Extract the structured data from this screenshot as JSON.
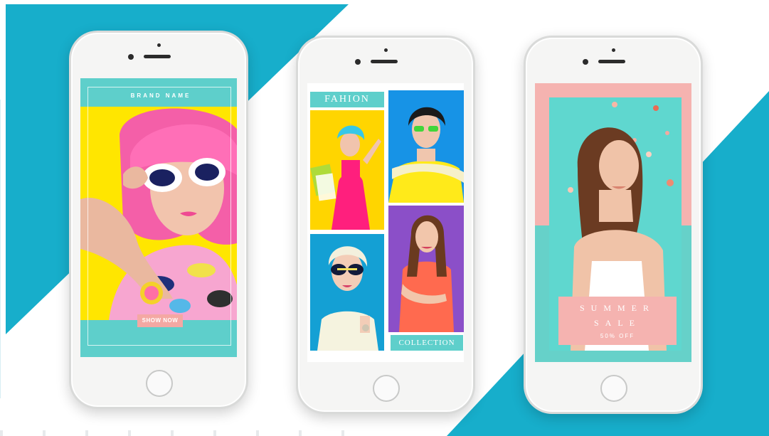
{
  "phones": [
    {
      "brand_name": "BRAND NAME",
      "button_label": "SHOW NOW"
    },
    {
      "title": "FAHION",
      "footer_label": "COLLECTION"
    },
    {
      "sale_line1": "SUMMER",
      "sale_line2": "SALE",
      "sale_line3": "50% OFF"
    }
  ],
  "colors": {
    "accent_teal": "#17aecb",
    "mint": "#5ecfcb",
    "pink": "#f5b3b0",
    "yellow": "#ffe600"
  }
}
